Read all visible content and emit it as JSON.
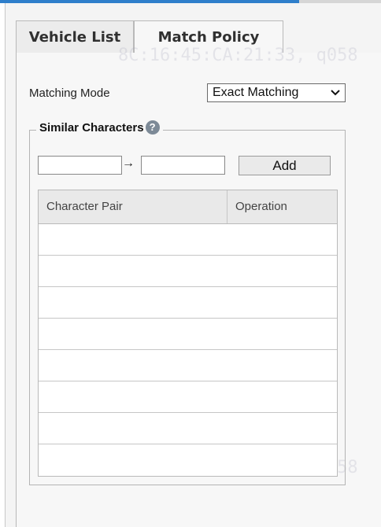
{
  "tabs": {
    "vehicle_list": "Vehicle List",
    "match_policy": "Match Policy"
  },
  "matching": {
    "label": "Matching Mode",
    "selected": "Exact Matching"
  },
  "similar": {
    "legend": "Similar Characters",
    "help": "?",
    "arrow": "→",
    "add_label": "Add"
  },
  "table": {
    "columns": [
      "Character Pair",
      "Operation"
    ],
    "rows": [
      [],
      [],
      [],
      [],
      [],
      [],
      [],
      []
    ]
  },
  "watermark": "8C:16:45:CA:21:33, q058",
  "colors": {
    "accent_bar": "#2f7fcb",
    "help_icon": "#7d8a97"
  }
}
